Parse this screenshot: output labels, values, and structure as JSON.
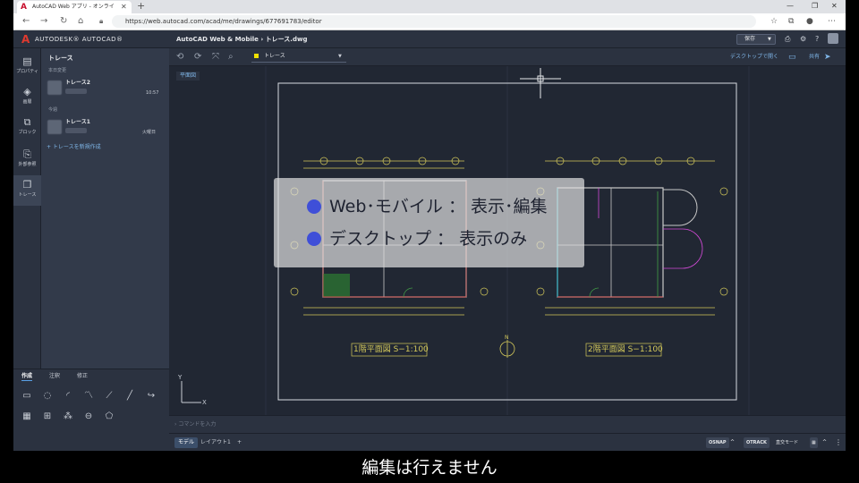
{
  "browser": {
    "tab_title": "AutoCAD Web アプリ - オンライン C",
    "tab_logo": "A",
    "url": "https://web.autocad.com/acad/me/drawings/677691783/editor"
  },
  "app": {
    "brand": "AUTODESK® AUTOCAD®",
    "breadcrumb": "AutoCAD Web & Mobile  ›  トレース.dwg",
    "save_label": "保存"
  },
  "rail": [
    {
      "label": "プロパティ",
      "icon": "properties-icon",
      "glyph": "▤"
    },
    {
      "label": "画層",
      "icon": "layers-icon",
      "glyph": "◈"
    },
    {
      "label": "ブロック",
      "icon": "block-icon",
      "glyph": "⧉"
    },
    {
      "label": "外部参照",
      "icon": "xref-icon",
      "glyph": "⎘"
    },
    {
      "label": "トレース",
      "icon": "trace-icon",
      "glyph": "❐"
    }
  ],
  "panel": {
    "title": "トレース",
    "group_recent": "本日変更",
    "group_today": "今週",
    "traces": [
      {
        "name": "トレース2",
        "time": "10:57"
      },
      {
        "name": "トレース1",
        "time": "火曜日"
      }
    ],
    "new_trace": "+  トレースを新規作成"
  },
  "tools": {
    "tabs": [
      "作成",
      "注釈",
      "修正"
    ]
  },
  "layer": {
    "name": "トレース",
    "color": "#f0e000"
  },
  "toolbar": {
    "open_desktop": "デスクトップで開く",
    "share": "共有"
  },
  "canvas": {
    "view_label": "平面図",
    "plan1_title": "1階平面図 S−1:100",
    "plan2_title": "2階平面図 S−1:100",
    "north": "N",
    "ucs_x": "X",
    "ucs_y": "Y"
  },
  "callout": {
    "line1": "Web･モバイル ： 表示･編集",
    "line2": "デスクトップ ： 表示のみ",
    "bullet_color": "#3f4fd8"
  },
  "command": {
    "placeholder": "コマンドを入力"
  },
  "status": {
    "model": "モデル",
    "layout": "レイアウト1",
    "add": "+",
    "osnap": "OSNAP",
    "otrack": "OTRACK",
    "ortho": "直交モード"
  },
  "subtitle": "編集は行えません"
}
